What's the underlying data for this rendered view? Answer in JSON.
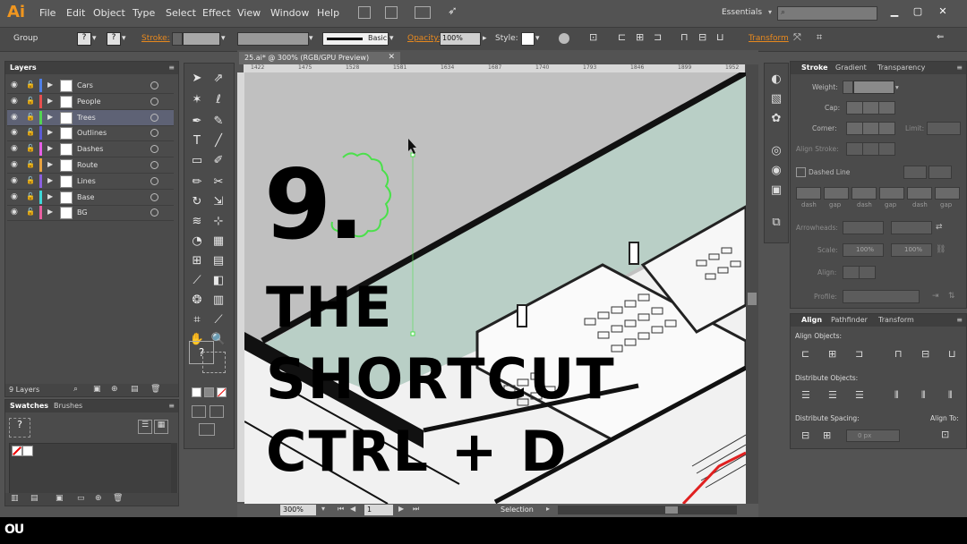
{
  "app": {
    "logo": "Ai",
    "workspace": "Essentials"
  },
  "menu": [
    "File",
    "Edit",
    "Object",
    "Type",
    "Select",
    "Effect",
    "View",
    "Window",
    "Help"
  ],
  "control": {
    "selection_label": "Group",
    "fill_q": "?",
    "stroke_q": "?",
    "stroke_label": "Stroke:",
    "brush_label": "Basic",
    "opacity_label": "Opacity:",
    "opacity_value": "100%",
    "style_label": "Style:",
    "transform_label": "Transform"
  },
  "layers_panel": {
    "tab": "Layers",
    "count": "9 Layers",
    "layers": [
      {
        "name": "Cars",
        "color": "#4f7fe8",
        "selected": false
      },
      {
        "name": "People",
        "color": "#e84f4f",
        "selected": false
      },
      {
        "name": "Trees",
        "color": "#52d452",
        "selected": true
      },
      {
        "name": "Outlines",
        "color": "#5b5bd4",
        "selected": false
      },
      {
        "name": "Dashes",
        "color": "#e65fe6",
        "selected": false
      },
      {
        "name": "Route",
        "color": "#e8a240",
        "selected": false
      },
      {
        "name": "Lines",
        "color": "#8a5fe0",
        "selected": false
      },
      {
        "name": "Base",
        "color": "#3fd8d8",
        "selected": false
      },
      {
        "name": "BG",
        "color": "#e85fa0",
        "selected": false
      }
    ]
  },
  "swatches_panel": {
    "tabs": [
      "Swatches",
      "Brushes"
    ],
    "q": "?"
  },
  "toolbar": {
    "question": "?"
  },
  "document": {
    "tab_title": "25.ai* @ 300% (RGB/GPU Preview)",
    "ruler_marks": [
      "1422",
      "1475",
      "1528",
      "1581",
      "1634",
      "1687",
      "1740",
      "1793",
      "1846",
      "1899",
      "1952"
    ],
    "zoom": "300%",
    "artboard_num": "1",
    "status": "Selection"
  },
  "overlay_text": {
    "line1": "9.",
    "line2": "THE",
    "line3": "SHORTCUT",
    "line4": "CTRL + D"
  },
  "stroke_panel": {
    "tabs": [
      "Stroke",
      "Gradient",
      "Transparency"
    ],
    "weight_label": "Weight:",
    "cap_label": "Cap:",
    "corner_label": "Corner:",
    "limit_label": "Limit:",
    "align_label": "Align Stroke:",
    "dashed_label": "Dashed Line",
    "dash_labels": [
      "dash",
      "gap",
      "dash",
      "gap",
      "dash",
      "gap"
    ],
    "arrowheads_label": "Arrowheads:",
    "scale_label": "Scale:",
    "scale1": "100%",
    "scale2": "100%",
    "align2_label": "Align:",
    "profile_label": "Profile:"
  },
  "align_panel": {
    "tabs": [
      "Align",
      "Pathfinder",
      "Transform"
    ],
    "align_objects": "Align Objects:",
    "distribute_objects": "Distribute Objects:",
    "distribute_spacing": "Distribute Spacing:",
    "align_to": "Align To:",
    "spacing_value": "0 px"
  },
  "watermark": "OU"
}
